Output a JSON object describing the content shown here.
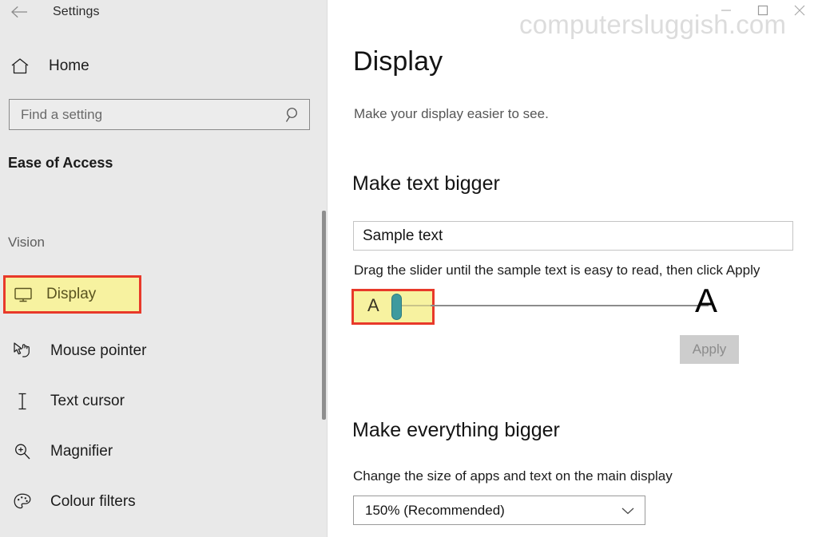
{
  "window": {
    "app_title": "Settings",
    "back_icon": "back-arrow-icon",
    "controls": {
      "minimize": "minimize-icon",
      "maximize": "maximize-icon",
      "close": "close-icon"
    }
  },
  "watermark": {
    "text": "computersluggish.com"
  },
  "sidebar": {
    "home_label": "Home",
    "home_icon": "home-icon",
    "search": {
      "placeholder": "Find a setting",
      "value": "",
      "icon": "search-icon"
    },
    "category_title": "Ease of Access",
    "group_header": "Vision",
    "items": [
      {
        "label": "Display",
        "icon": "monitor-icon",
        "selected": true
      },
      {
        "label": "Mouse pointer",
        "icon": "mouse-pointer-icon",
        "selected": false
      },
      {
        "label": "Text cursor",
        "icon": "text-cursor-icon",
        "selected": false
      },
      {
        "label": "Magnifier",
        "icon": "magnifier-icon",
        "selected": false
      },
      {
        "label": "Colour filters",
        "icon": "palette-icon",
        "selected": false
      }
    ]
  },
  "main": {
    "page_title": "Display",
    "page_subtitle": "Make your display easier to see.",
    "text_section": {
      "heading": "Make text bigger",
      "sample_text": "Sample text",
      "hint": "Drag the slider until the sample text is easy to read, then click Apply",
      "slider": {
        "min_label": "A",
        "max_label": "A",
        "value": 0,
        "min": 0,
        "max": 100
      },
      "apply_label": "Apply",
      "apply_disabled": true
    },
    "scale_section": {
      "heading": "Make everything bigger",
      "label": "Change the size of apps and text on the main display",
      "selected_option": "150% (Recommended)",
      "chevron_icon": "chevron-down-icon"
    }
  },
  "colors": {
    "highlight_fill": "#f7f2a0",
    "highlight_border": "#e8392a",
    "slider_thumb": "#3f9a9e",
    "sidebar_bg": "#e9e9e9"
  }
}
